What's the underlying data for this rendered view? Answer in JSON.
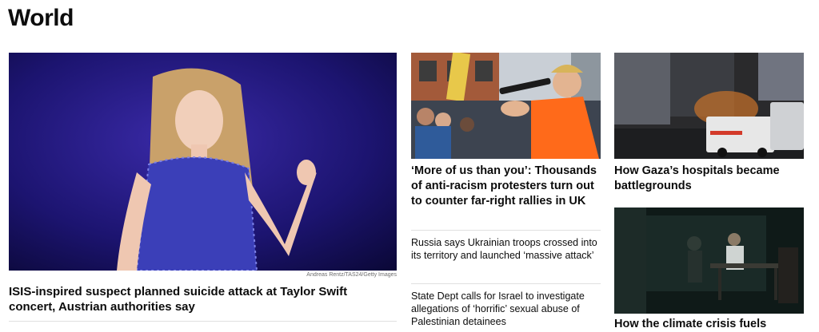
{
  "section_title": "World",
  "lead": {
    "photo_credit": "Andreas Rentz/TAS24/Getty Images",
    "headline": "ISIS-inspired suspect planned suicide attack at Taylor Swift concert, Austrian authorities say"
  },
  "middle": {
    "top_headline": "‘More of us than you’: Thousands of anti-racism protesters turn out to counter far-right rallies in UK",
    "items": [
      {
        "headline": "Russia says Ukrainian troops crossed into its territory and launched ‘massive attack’"
      },
      {
        "headline": "State Dept calls for Israel to investigate allegations of ‘horrific’ sexual abuse of Palestinian detainees"
      }
    ]
  },
  "right": {
    "top_headline": "How Gaza’s hospitals became battlegrounds",
    "second_headline_partial": "How the climate crisis fuels"
  }
}
